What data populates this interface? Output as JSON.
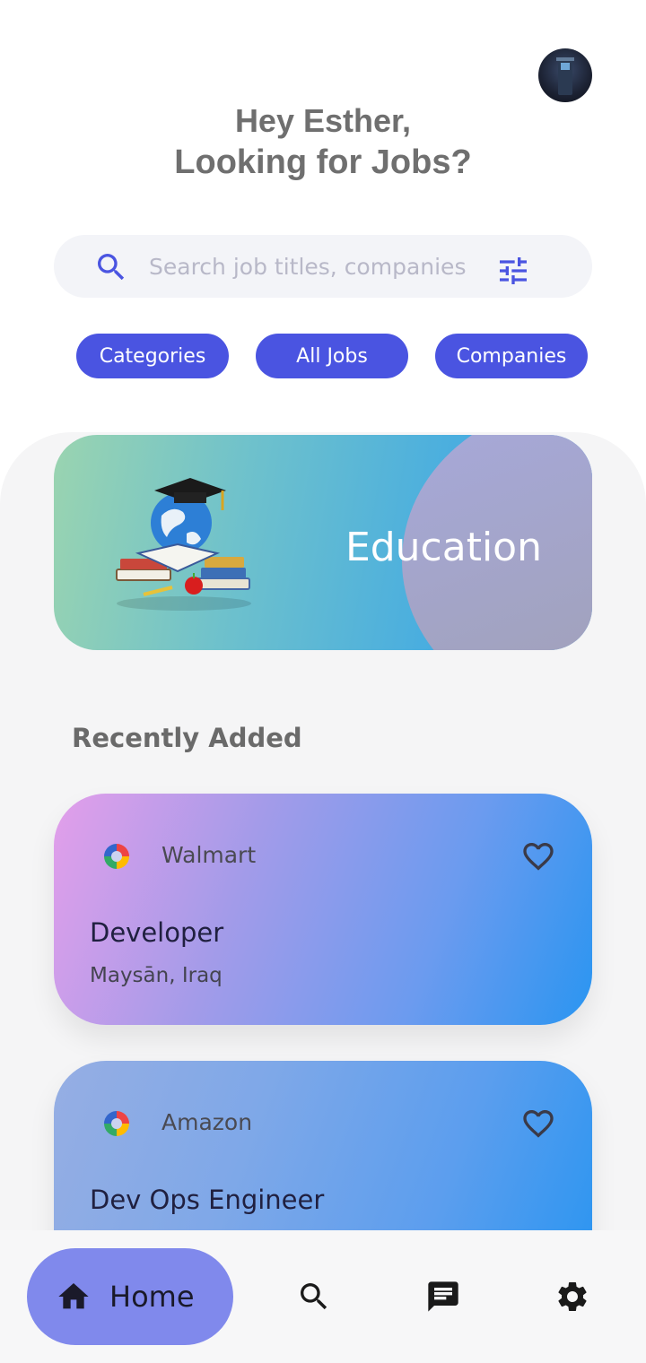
{
  "greeting": {
    "line1": "Hey Esther,",
    "line2": "Looking for Jobs?"
  },
  "search": {
    "placeholder": "Search job titles, companies"
  },
  "chips": [
    {
      "label": "Categories"
    },
    {
      "label": "All Jobs"
    },
    {
      "label": "Companies"
    }
  ],
  "banner": {
    "label": "Education"
  },
  "recent": {
    "title": "Recently Added"
  },
  "jobs": [
    {
      "company": "Walmart",
      "title": "Developer",
      "location": "Maysān, Iraq"
    },
    {
      "company": "Amazon",
      "title": "Dev Ops Engineer",
      "location": ""
    }
  ],
  "nav": {
    "home_label": "Home"
  },
  "icons": [
    "avatar",
    "search-icon",
    "filter-icon",
    "heart-icon",
    "home-icon",
    "chat-icon",
    "gear-icon"
  ],
  "colors": {
    "accent": "#4a54e1",
    "nav_active": "#8089ec"
  }
}
